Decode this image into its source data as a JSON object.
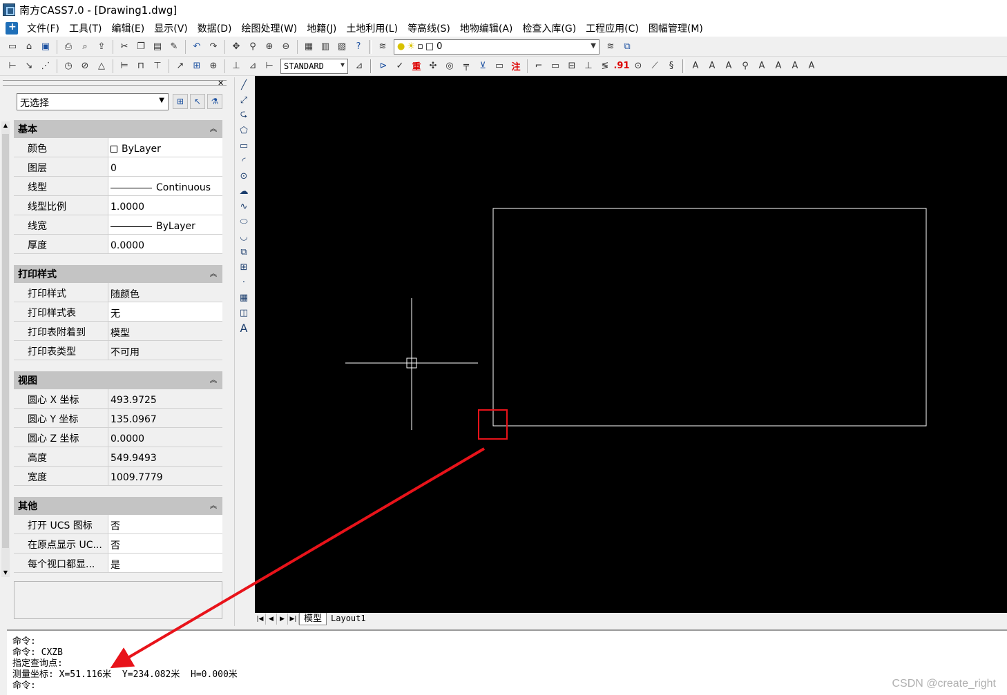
{
  "window": {
    "title": "南方CASS7.0 - [Drawing1.dwg]"
  },
  "menu": [
    "文件(F)",
    "工具(T)",
    "编辑(E)",
    "显示(V)",
    "数据(D)",
    "绘图处理(W)",
    "地籍(J)",
    "土地利用(L)",
    "等高线(S)",
    "地物编辑(A)",
    "检查入库(G)",
    "工程应用(C)",
    "图幅管理(M)"
  ],
  "toolbar": {
    "layer_value": "0",
    "text_style": "STANDARD",
    "glyph_zhong": "重",
    "glyph_zhu": "注",
    "glyph_91": ".91"
  },
  "properties": {
    "selection": "无选择",
    "sections": [
      {
        "title": "基本",
        "rows": [
          {
            "key": "颜色",
            "value": "ByLayer"
          },
          {
            "key": "图层",
            "value": "0"
          },
          {
            "key": "线型",
            "value": "Continuous"
          },
          {
            "key": "线型比例",
            "value": "1.0000"
          },
          {
            "key": "线宽",
            "value": "ByLayer"
          },
          {
            "key": "厚度",
            "value": "0.0000"
          }
        ]
      },
      {
        "title": "打印样式",
        "rows": [
          {
            "key": "打印样式",
            "value": "随颜色"
          },
          {
            "key": "打印样式表",
            "value": "无"
          },
          {
            "key": "打印表附着到",
            "value": "模型"
          },
          {
            "key": "打印表类型",
            "value": "不可用"
          }
        ]
      },
      {
        "title": "视图",
        "rows": [
          {
            "key": "圆心 X 坐标",
            "value": "493.9725"
          },
          {
            "key": "圆心 Y 坐标",
            "value": "135.0967"
          },
          {
            "key": "圆心 Z 坐标",
            "value": "0.0000"
          },
          {
            "key": "高度",
            "value": "549.9493"
          },
          {
            "key": "宽度",
            "value": "1009.7779"
          }
        ]
      },
      {
        "title": "其他",
        "rows": [
          {
            "key": "打开 UCS 图标",
            "value": "否"
          },
          {
            "key": "在原点显示 UC...",
            "value": "否"
          },
          {
            "key": "每个视口都显...",
            "value": "是"
          }
        ]
      }
    ]
  },
  "tabs": [
    "模型",
    "Layout1"
  ],
  "command_lines": [
    "命令:",
    "命令: CXZB",
    "指定查询点:",
    "测量坐标: X=51.116米  Y=234.082米  H=0.000米",
    "命令:"
  ],
  "watermark": "CSDN @create_right",
  "colors": {
    "canvas_bg": "#000000",
    "annotation": "#e8131a",
    "drawing_line": "#ffffff"
  }
}
